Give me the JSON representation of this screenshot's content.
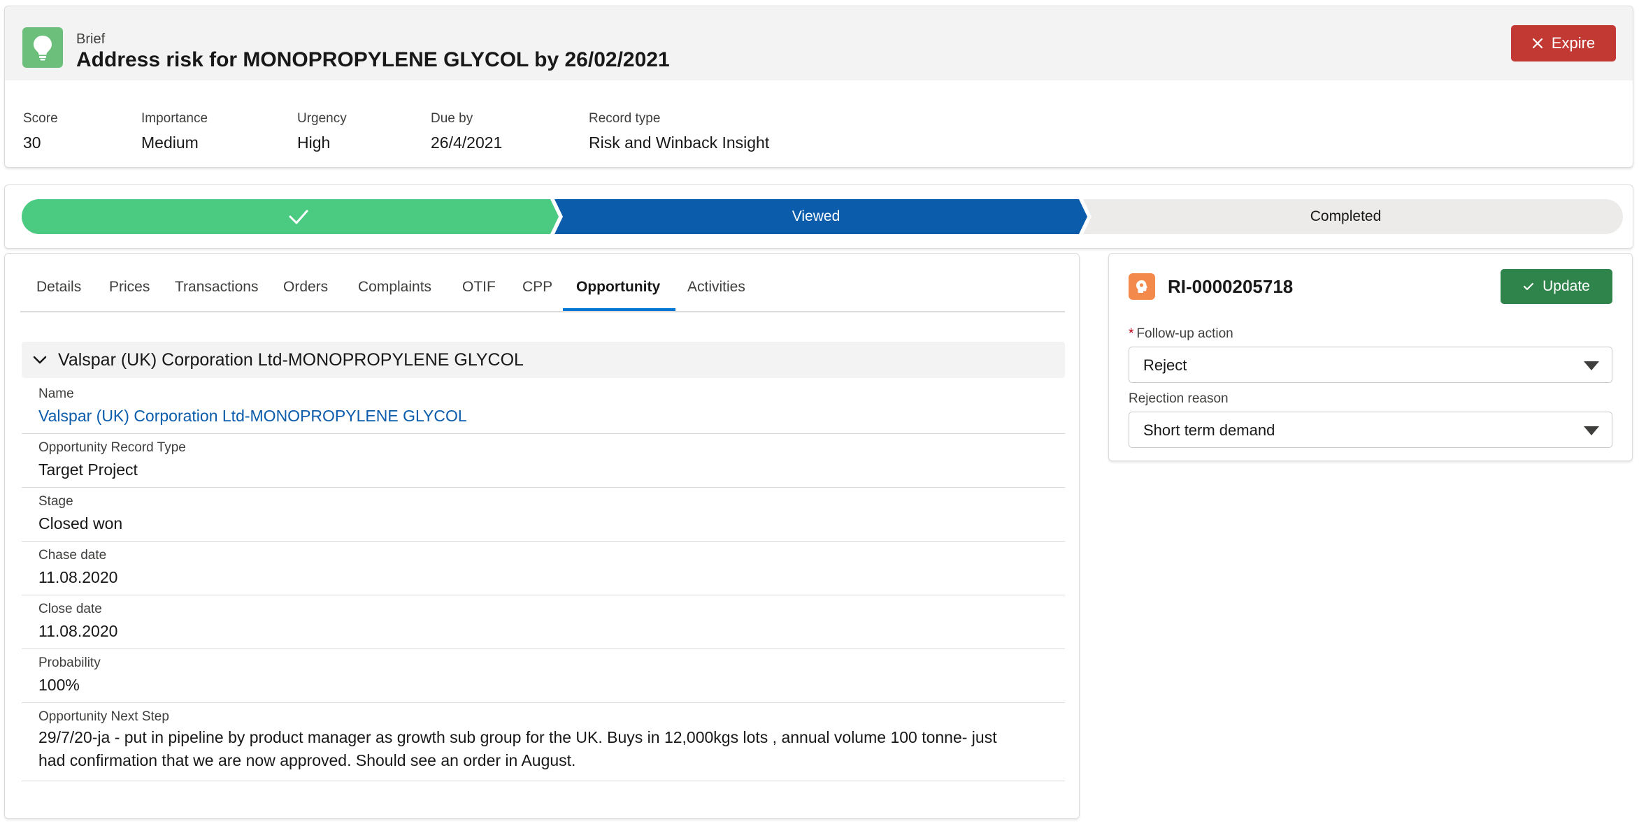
{
  "header": {
    "eyebrow": "Brief",
    "title": "Address risk for MONOPROPYLENE GLYCOL by 26/02/2021",
    "expire_label": "Expire",
    "icon": "lightbulb-icon",
    "icon_color": "#6cbf7b",
    "fields": [
      {
        "label": "Score",
        "value": "30"
      },
      {
        "label": "Importance",
        "value": "Medium"
      },
      {
        "label": "Urgency",
        "value": "High"
      },
      {
        "label": "Due by",
        "value": "26/4/2021"
      },
      {
        "label": "Record type",
        "value": "Risk and Winback Insight"
      }
    ]
  },
  "path": {
    "stages": [
      {
        "label": "",
        "state": "complete",
        "color": "#4bca81"
      },
      {
        "label": "Viewed",
        "state": "current",
        "color": "#0b5cab"
      },
      {
        "label": "Completed",
        "state": "incomplete",
        "color": "#ecebea"
      }
    ]
  },
  "tabs": {
    "items": [
      "Details",
      "Prices",
      "Transactions",
      "Orders",
      "Complaints",
      "OTIF",
      "CPP",
      "Opportunity",
      "Activities"
    ],
    "active": "Opportunity",
    "accent": "#0176d3"
  },
  "opportunity": {
    "section_title": "Valspar (UK) Corporation Ltd-MONOPROPYLENE GLYCOL",
    "fields": [
      {
        "label": "Name",
        "value": "Valspar (UK) Corporation Ltd-MONOPROPYLENE GLYCOL"
      },
      {
        "label": "Opportunity Record Type",
        "value": "Target Project"
      },
      {
        "label": "Stage",
        "value": "Closed won"
      },
      {
        "label": "Chase date",
        "value": "11.08.2020"
      },
      {
        "label": "Close date",
        "value": "11.08.2020"
      },
      {
        "label": "Probability",
        "value": "100%"
      },
      {
        "label": "Opportunity Next Step",
        "value_line1": "29/7/20-ja - put in pipeline by product manager as growth sub group for the UK. Buys in 12,000kgs lots , annual volume 100 tonne- just",
        "value_line2": "had confirmation that we are now approved. Should see an order in August."
      }
    ]
  },
  "side": {
    "record_id": "RI-0000205718",
    "update_label": "Update",
    "icon": "insight-icon",
    "icon_color": "#f38a4b",
    "follow_up": {
      "label": "Follow-up action",
      "required_marker": "*",
      "value": "Reject"
    },
    "rejection": {
      "label": "Rejection reason",
      "value": "Short term demand"
    }
  }
}
